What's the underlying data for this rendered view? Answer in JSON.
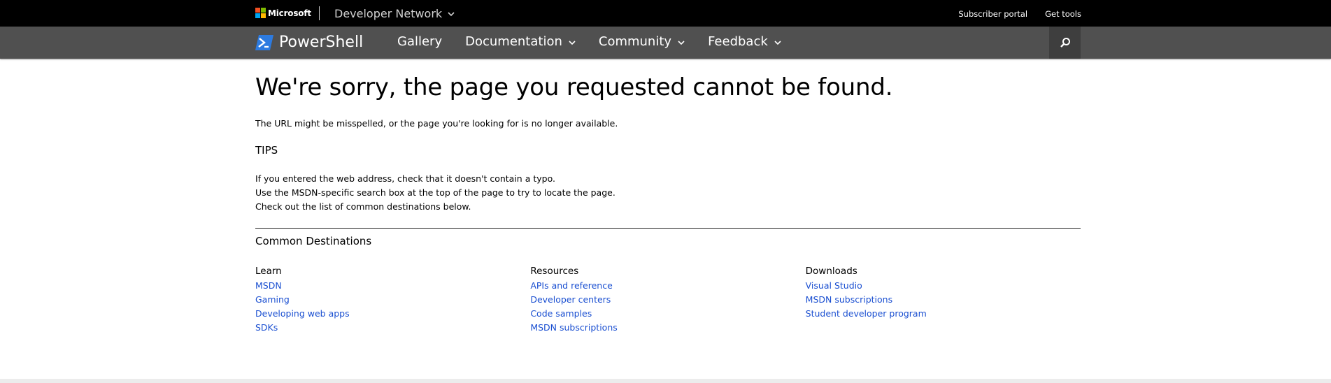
{
  "topbar": {
    "brand": "Microsoft",
    "network": "Developer Network",
    "links": [
      "Subscriber portal",
      "Get tools"
    ],
    "logo_colors": [
      "#f25022",
      "#7fba00",
      "#00a4ef",
      "#ffb900"
    ]
  },
  "navbar": {
    "product": "PowerShell",
    "items": [
      "Gallery",
      "Documentation",
      "Community",
      "Feedback"
    ],
    "search_icon": "search-icon"
  },
  "main": {
    "title": "We're sorry, the page you requested cannot be found.",
    "subtitle": "The URL might be misspelled, or the page you're looking for is no longer available.",
    "tips_heading": "TIPS",
    "tips": [
      "If you entered the web address, check that it doesn't contain a typo.",
      "Use the MSDN-specific search box at the top of the page to try to locate the page.",
      "Check out the list of common destinations below."
    ],
    "common_heading": "Common Destinations",
    "columns": [
      {
        "heading": "Learn",
        "links": [
          "MSDN",
          "Gaming",
          "Developing web apps",
          "SDKs"
        ]
      },
      {
        "heading": "Resources",
        "links": [
          "APIs and reference",
          "Developer centers",
          "Code samples",
          "MSDN subscriptions"
        ]
      },
      {
        "heading": "Downloads",
        "links": [
          "Visual Studio",
          "MSDN subscriptions",
          "Student developer program"
        ]
      }
    ],
    "link_color": "#1a4fd1"
  }
}
